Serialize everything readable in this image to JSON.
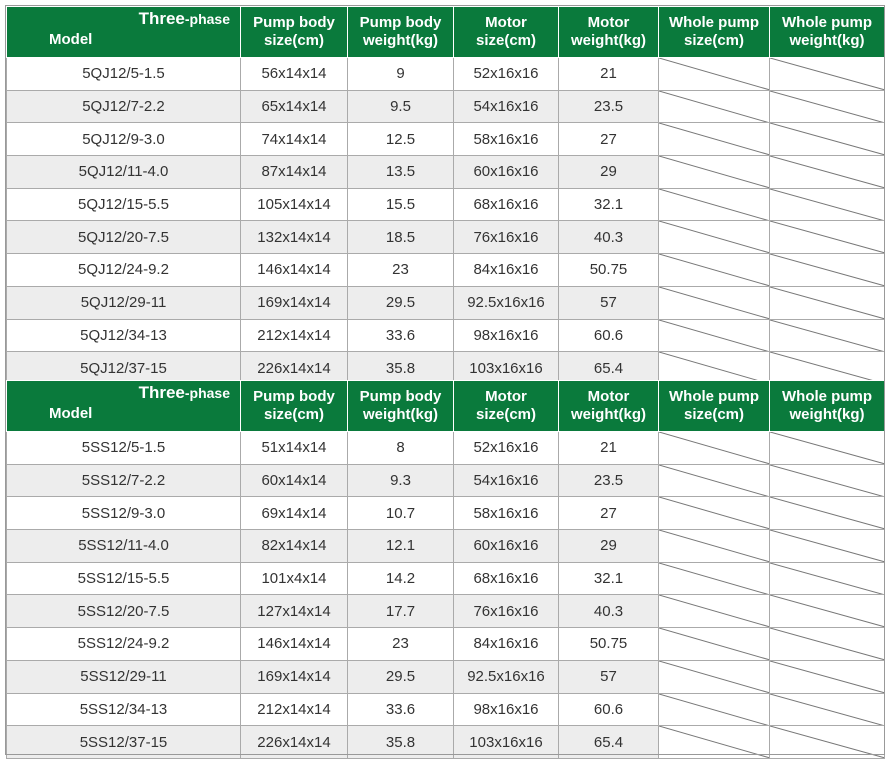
{
  "header": {
    "phase_word": "Three",
    "phase_suffix": "-phase",
    "model": "Model",
    "columns": [
      [
        "Pump body",
        "size(cm)"
      ],
      [
        "Pump body",
        "weight(kg)"
      ],
      [
        "Motor",
        "size(cm)"
      ],
      [
        "Motor",
        "weight(kg)"
      ],
      [
        "Whole pump",
        "size(cm)"
      ],
      [
        "Whole pump",
        "weight(kg)"
      ]
    ]
  },
  "tables": [
    {
      "rows": [
        [
          "5QJ12/5-1.5",
          "56x14x14",
          "9",
          "52x16x16",
          "21"
        ],
        [
          "5QJ12/7-2.2",
          "65x14x14",
          "9.5",
          "54x16x16",
          "23.5"
        ],
        [
          "5QJ12/9-3.0",
          "74x14x14",
          "12.5",
          "58x16x16",
          "27"
        ],
        [
          "5QJ12/11-4.0",
          "87x14x14",
          "13.5",
          "60x16x16",
          "29"
        ],
        [
          "5QJ12/15-5.5",
          "105x14x14",
          "15.5",
          "68x16x16",
          "32.1"
        ],
        [
          "5QJ12/20-7.5",
          "132x14x14",
          "18.5",
          "76x16x16",
          "40.3"
        ],
        [
          "5QJ12/24-9.2",
          "146x14x14",
          "23",
          "84x16x16",
          "50.75"
        ],
        [
          "5QJ12/29-11",
          "169x14x14",
          "29.5",
          "92.5x16x16",
          "57"
        ],
        [
          "5QJ12/34-13",
          "212x14x14",
          "33.6",
          "98x16x16",
          "60.6"
        ],
        [
          "5QJ12/37-15",
          "226x14x14",
          "35.8",
          "103x16x16",
          "65.4"
        ]
      ]
    },
    {
      "rows": [
        [
          "5SS12/5-1.5",
          "51x14x14",
          "8",
          "52x16x16",
          "21"
        ],
        [
          "5SS12/7-2.2",
          "60x14x14",
          "9.3",
          "54x16x16",
          "23.5"
        ],
        [
          "5SS12/9-3.0",
          "69x14x14",
          "10.7",
          "58x16x16",
          "27"
        ],
        [
          "5SS12/11-4.0",
          "82x14x14",
          "12.1",
          "60x16x16",
          "29"
        ],
        [
          "5SS12/15-5.5",
          "101x4x14",
          "14.2",
          "68x16x16",
          "32.1"
        ],
        [
          "5SS12/20-7.5",
          "127x14x14",
          "17.7",
          "76x16x16",
          "40.3"
        ],
        [
          "5SS12/24-9.2",
          "146x14x14",
          "23",
          "84x16x16",
          "50.75"
        ],
        [
          "5SS12/29-11",
          "169x14x14",
          "29.5",
          "92.5x16x16",
          "57"
        ],
        [
          "5SS12/34-13",
          "212x14x14",
          "33.6",
          "98x16x16",
          "60.6"
        ],
        [
          "5SS12/37-15",
          "226x14x14",
          "35.8",
          "103x16x16",
          "65.4"
        ]
      ]
    }
  ],
  "colors": {
    "header_bg": "#0a7a3c",
    "header_text": "#ffffff",
    "stripe": "#ededed",
    "grid": "#aaaaaa",
    "text": "#333333"
  }
}
